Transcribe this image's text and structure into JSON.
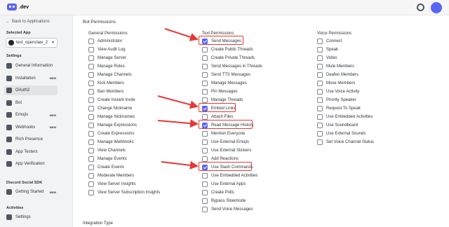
{
  "topbar": {
    "brand": ".dev",
    "theme_icon": "sun-icon"
  },
  "sidebar": {
    "back_label": "Back to Applications",
    "selected_app_heading": "Selected App",
    "selected_app_value": "test_openclaw_2",
    "settings_heading": "Settings",
    "settings_items": [
      {
        "label": "General Information",
        "icon": "home-icon",
        "badge": ""
      },
      {
        "label": "Installation",
        "icon": "gear-icon",
        "badge": "NEW"
      },
      {
        "label": "OAuth2",
        "icon": "wrench-icon",
        "badge": ""
      },
      {
        "label": "Bot",
        "icon": "puzzle-icon",
        "badge": ""
      },
      {
        "label": "Emojis",
        "icon": "smile-icon",
        "badge": "NEW"
      },
      {
        "label": "Webhooks",
        "icon": "webhook-icon",
        "badge": "NEW"
      },
      {
        "label": "Rich Presence",
        "icon": "document-icon",
        "badge": ""
      },
      {
        "label": "App Testers",
        "icon": "person-icon",
        "badge": ""
      },
      {
        "label": "App Verification",
        "icon": "check-circle-icon",
        "badge": ""
      }
    ],
    "sdk_heading": "Discord Social SDK",
    "sdk_items": [
      {
        "label": "Getting Started",
        "icon": "flag-icon",
        "badge": "NEW"
      }
    ],
    "activities_heading": "Activities",
    "activities_items": [
      {
        "label": "Settings",
        "icon": "move-icon",
        "badge": ""
      }
    ]
  },
  "main": {
    "title": "Bot Permissions",
    "integration_type_label": "Integration Type",
    "columns": [
      {
        "title": "General Permissions",
        "perms": [
          {
            "label": "Administrator",
            "checked": false
          },
          {
            "label": "View Audit Log",
            "checked": false
          },
          {
            "label": "Manage Server",
            "checked": false
          },
          {
            "label": "Manage Roles",
            "checked": false
          },
          {
            "label": "Manage Channels",
            "checked": false
          },
          {
            "label": "Kick Members",
            "checked": false
          },
          {
            "label": "Ban Members",
            "checked": false
          },
          {
            "label": "Create Instant Invite",
            "checked": false
          },
          {
            "label": "Change Nickname",
            "checked": false
          },
          {
            "label": "Manage Nicknames",
            "checked": false
          },
          {
            "label": "Manage Expressions",
            "checked": false
          },
          {
            "label": "Create Expressions",
            "checked": false
          },
          {
            "label": "Manage Webhooks",
            "checked": false
          },
          {
            "label": "View Channels",
            "checked": false
          },
          {
            "label": "Manage Events",
            "checked": false
          },
          {
            "label": "Create Events",
            "checked": false
          },
          {
            "label": "Moderate Members",
            "checked": false
          },
          {
            "label": "View Server Insights",
            "checked": false
          },
          {
            "label": "View Server Subscription Insights",
            "checked": false
          }
        ]
      },
      {
        "title": "Text Permissions",
        "perms": [
          {
            "label": "Send Messages",
            "checked": true
          },
          {
            "label": "Create Public Threads",
            "checked": false
          },
          {
            "label": "Create Private Threads",
            "checked": false
          },
          {
            "label": "Send Messages in Threads",
            "checked": false
          },
          {
            "label": "Send TTS Messages",
            "checked": false
          },
          {
            "label": "Manage Messages",
            "checked": false
          },
          {
            "label": "Pin Messages",
            "checked": false
          },
          {
            "label": "Manage Threads",
            "checked": false
          },
          {
            "label": "Embed Links",
            "checked": true
          },
          {
            "label": "Attach Files",
            "checked": false
          },
          {
            "label": "Read Message History",
            "checked": true
          },
          {
            "label": "Mention Everyone",
            "checked": false
          },
          {
            "label": "Use External Emojis",
            "checked": false
          },
          {
            "label": "Use External Stickers",
            "checked": false
          },
          {
            "label": "Add Reactions",
            "checked": false
          },
          {
            "label": "Use Slash Commands",
            "checked": true
          },
          {
            "label": "Use Embedded Activities",
            "checked": false
          },
          {
            "label": "Use External Apps",
            "checked": false
          },
          {
            "label": "Create Polls",
            "checked": false
          },
          {
            "label": "Bypass Slowmode",
            "checked": false
          },
          {
            "label": "Send Voice Messages",
            "checked": false
          }
        ]
      },
      {
        "title": "Voice Permissions",
        "perms": [
          {
            "label": "Connect",
            "checked": false
          },
          {
            "label": "Speak",
            "checked": false
          },
          {
            "label": "Video",
            "checked": false
          },
          {
            "label": "Mute Members",
            "checked": false
          },
          {
            "label": "Deafen Members",
            "checked": false
          },
          {
            "label": "Move Members",
            "checked": false
          },
          {
            "label": "Use Voice Activity",
            "checked": false
          },
          {
            "label": "Priority Speaker",
            "checked": false
          },
          {
            "label": "Request To Speak",
            "checked": false
          },
          {
            "label": "Use Embedded Activities",
            "checked": false
          },
          {
            "label": "Use Soundboard",
            "checked": false
          },
          {
            "label": "Use External Sounds",
            "checked": false
          },
          {
            "label": "Set Voice Channel Status",
            "checked": false
          }
        ]
      }
    ]
  },
  "colors": {
    "accent": "#5865f2",
    "annotation": "#e53935"
  }
}
